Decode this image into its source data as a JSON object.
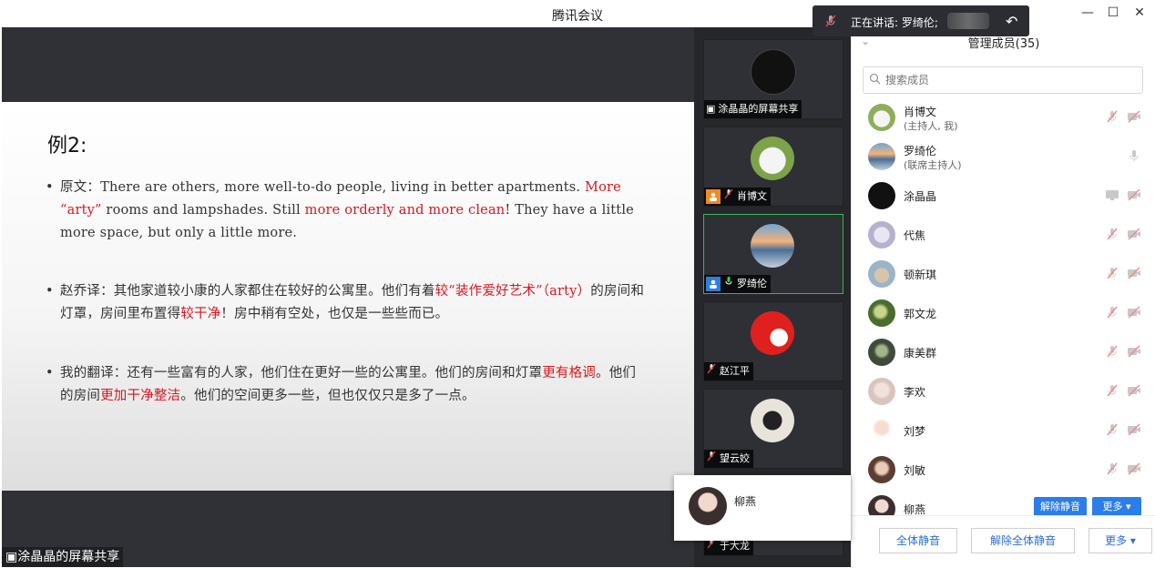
{
  "app": {
    "title": "腾讯会议"
  },
  "speaking": {
    "text": "正在讲话: 罗绮伦;"
  },
  "share": {
    "label": "涂晶晶的屏幕共享"
  },
  "slide": {
    "heading": "例2:",
    "p1": {
      "t1": "原文：There are others, more well-to-do people, living in better apartments. ",
      "r1": "More “arty”",
      "t2": " rooms and lampshades. Still ",
      "r2": "more orderly and more clean",
      "t3": "! They have a little more space, but only a little more."
    },
    "p2": {
      "t1": "赵乔译：其他家道较小康的人家都住在较好的公寓里。他们有着",
      "r1": "较“装作爱好艺术”（arty）",
      "t2": "的房间和灯罩，房间里布置得",
      "r2": "较干净",
      "t3": "！房中稍有空处，也仅是一些些而已。"
    },
    "p3": {
      "t1": "我的翻译：还有一些富有的人家，他们住在更好一些的公寓里。他们的房间和灯罩",
      "r1": "更有格调",
      "t2": "。他们的房间",
      "r2": "更加干净整洁",
      "t3": "。他们的空间更多一些，但也仅仅只是多了一点。"
    }
  },
  "tiles": [
    {
      "label": "涂晶晶的屏幕共享"
    },
    {
      "label": "肖博文"
    },
    {
      "label": "罗绮伦"
    },
    {
      "label": "赵江平"
    },
    {
      "label": "望云姣"
    },
    {
      "label": "于大龙"
    }
  ],
  "popup": {
    "name": "柳燕"
  },
  "panel": {
    "title": "管理成员(35)",
    "search_placeholder": "搜索成员",
    "members": [
      {
        "name": "肖博文",
        "role": "(主持人, 我)"
      },
      {
        "name": "罗绮伦",
        "role": "(联席主持人)"
      },
      {
        "name": "涂晶晶"
      },
      {
        "name": "代焦"
      },
      {
        "name": "顿新琪"
      },
      {
        "name": "郭文龙"
      },
      {
        "name": "康美群"
      },
      {
        "name": "李欢"
      },
      {
        "name": "刘梦"
      },
      {
        "name": "刘敏"
      },
      {
        "name": "柳燕"
      }
    ],
    "unmute_label": "解除静音",
    "more_label": "更多 ▾",
    "mute_all": "全体静音",
    "unmute_all": "解除全体静音",
    "more_bottom": "更多 ▾"
  },
  "colors": {
    "accent": "#2b7de9",
    "active_border": "#3bb54a",
    "highlight_red": "#d6171e"
  }
}
